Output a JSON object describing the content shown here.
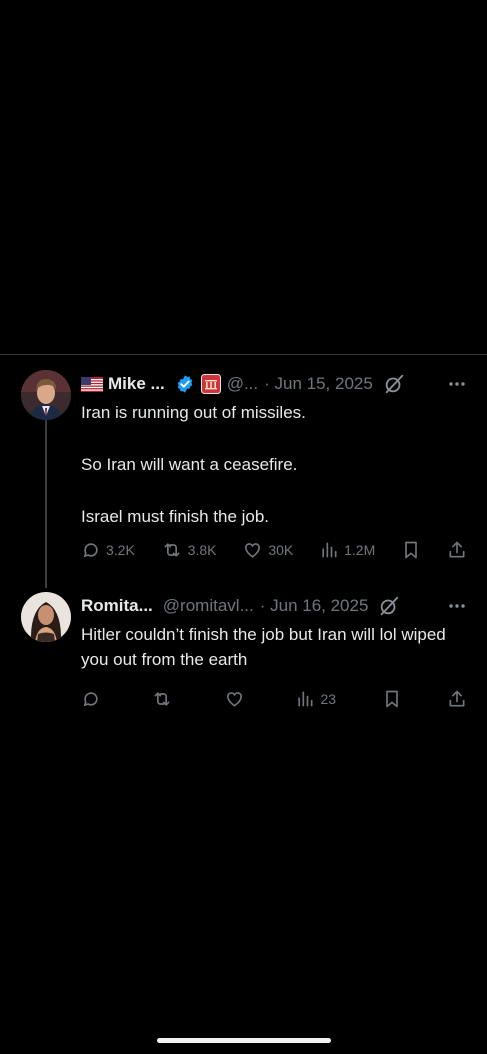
{
  "tweets": [
    {
      "name": "Mike ...",
      "handle": "@...",
      "date": "· Jun 15, 2025",
      "lines": [
        "Iran is running out of missiles.",
        "So Iran will want a ceasefire.",
        "Israel must finish the job."
      ],
      "replies": "3.2K",
      "reposts": "3.8K",
      "likes": "30K",
      "views": "1.2M"
    },
    {
      "name": "Romita...",
      "handle": "@romitavl...",
      "date": "· Jun 16, 2025",
      "lines": [
        "Hitler couldn’t finish the job but Iran will lol wiped you out from the earth"
      ],
      "replies": "",
      "reposts": "",
      "likes": "",
      "views": "23"
    }
  ],
  "colors": {
    "background": "#000000",
    "text": "#e7e9ea",
    "muted": "#71767b",
    "verified": "#1d9bf0",
    "affiliation_badge": "#d0343a"
  },
  "icons": [
    "us-flag-icon",
    "verified-badge-icon",
    "affiliation-badge-icon",
    "grok-icon",
    "more-icon",
    "reply-icon",
    "repost-icon",
    "like-icon",
    "views-icon",
    "bookmark-icon",
    "share-icon"
  ]
}
